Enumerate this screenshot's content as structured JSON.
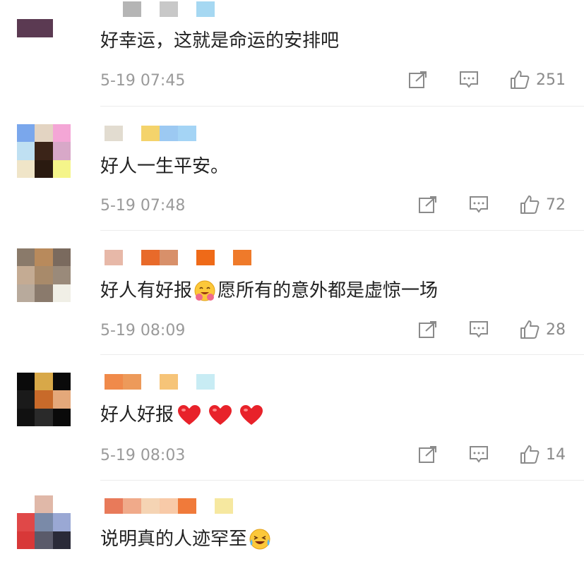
{
  "comments": [
    {
      "text_before": "好幸运，这就是命运的安排吧",
      "text_after": "",
      "time": "5-19 07:45",
      "likes": "251",
      "avatar_colors": [
        "#ffffff",
        "#ffffff",
        "#ffffff",
        "#5b3a52",
        "#5b3a52",
        "#ffffff",
        "#ffffff",
        "#ffffff",
        "#ffffff"
      ],
      "name_colors": [
        "#ffffff",
        "#b5b5b5",
        "#ffffff",
        "#c8c8c8",
        "#ffffff",
        "#a6d8f2"
      ]
    },
    {
      "text_before": "好人一生平安。",
      "text_after": "",
      "time": "5-19 07:48",
      "likes": "72",
      "avatar_colors": [
        "#7aa7ec",
        "#e3d4c2",
        "#f4a6d6",
        "#bfe0f2",
        "#3b2418",
        "#d8a8c8",
        "#f0e5c8",
        "#2a1a10",
        "#f5f58a"
      ],
      "name_colors": [
        "#e2dcd0",
        "#ffffff",
        "#f4d36b",
        "#9cc9f2",
        "#a4d4f5",
        "#ffffff"
      ]
    },
    {
      "text_before": "好人有好报",
      "text_middle": "愿所有的意外都是虚惊一场",
      "time": "5-19 08:09",
      "likes": "28",
      "avatar_colors": [
        "#8a7a6a",
        "#b88a5c",
        "#7a6a5e",
        "#c4ab93",
        "#a88a6a",
        "#9a8a7a",
        "#b8aa9c",
        "#8a7a6c",
        "#f0efe6"
      ],
      "name_colors": [
        "#e7b8a8",
        "#ffffff",
        "#e86a2a",
        "#d8906a",
        "#ffffff",
        "#ef6a18",
        "#ffffff",
        "#ef7a2a"
      ]
    },
    {
      "text_before": "好人好报",
      "text_after": "",
      "time": "5-19 08:03",
      "likes": "14",
      "avatar_colors": [
        "#0a0a0a",
        "#d8a848",
        "#0a0a0a",
        "#1a1a1a",
        "#c86a2a",
        "#e4a87a",
        "#111111",
        "#2a2a2a",
        "#0a0a0a"
      ],
      "name_colors": [
        "#f08a4a",
        "#ed9a5a",
        "#ffffff",
        "#f6c478",
        "#ffffff",
        "#c8ecf4"
      ]
    },
    {
      "text_before": "说明真的人迹罕至",
      "text_after": "",
      "time": "",
      "likes": "",
      "avatar_colors": [
        "#ffffff",
        "#e0b8a8",
        "#ffffff",
        "#e04848",
        "#7a8aa8",
        "#9aa8d4",
        "#d83838",
        "#5a5a6a",
        "#2a2a38"
      ],
      "name_colors": [
        "#e87a5a",
        "#f0aa8a",
        "#f5d4b4",
        "#f8caa8",
        "#f07a3a",
        "#ffffff",
        "#f6e8a0"
      ]
    }
  ]
}
